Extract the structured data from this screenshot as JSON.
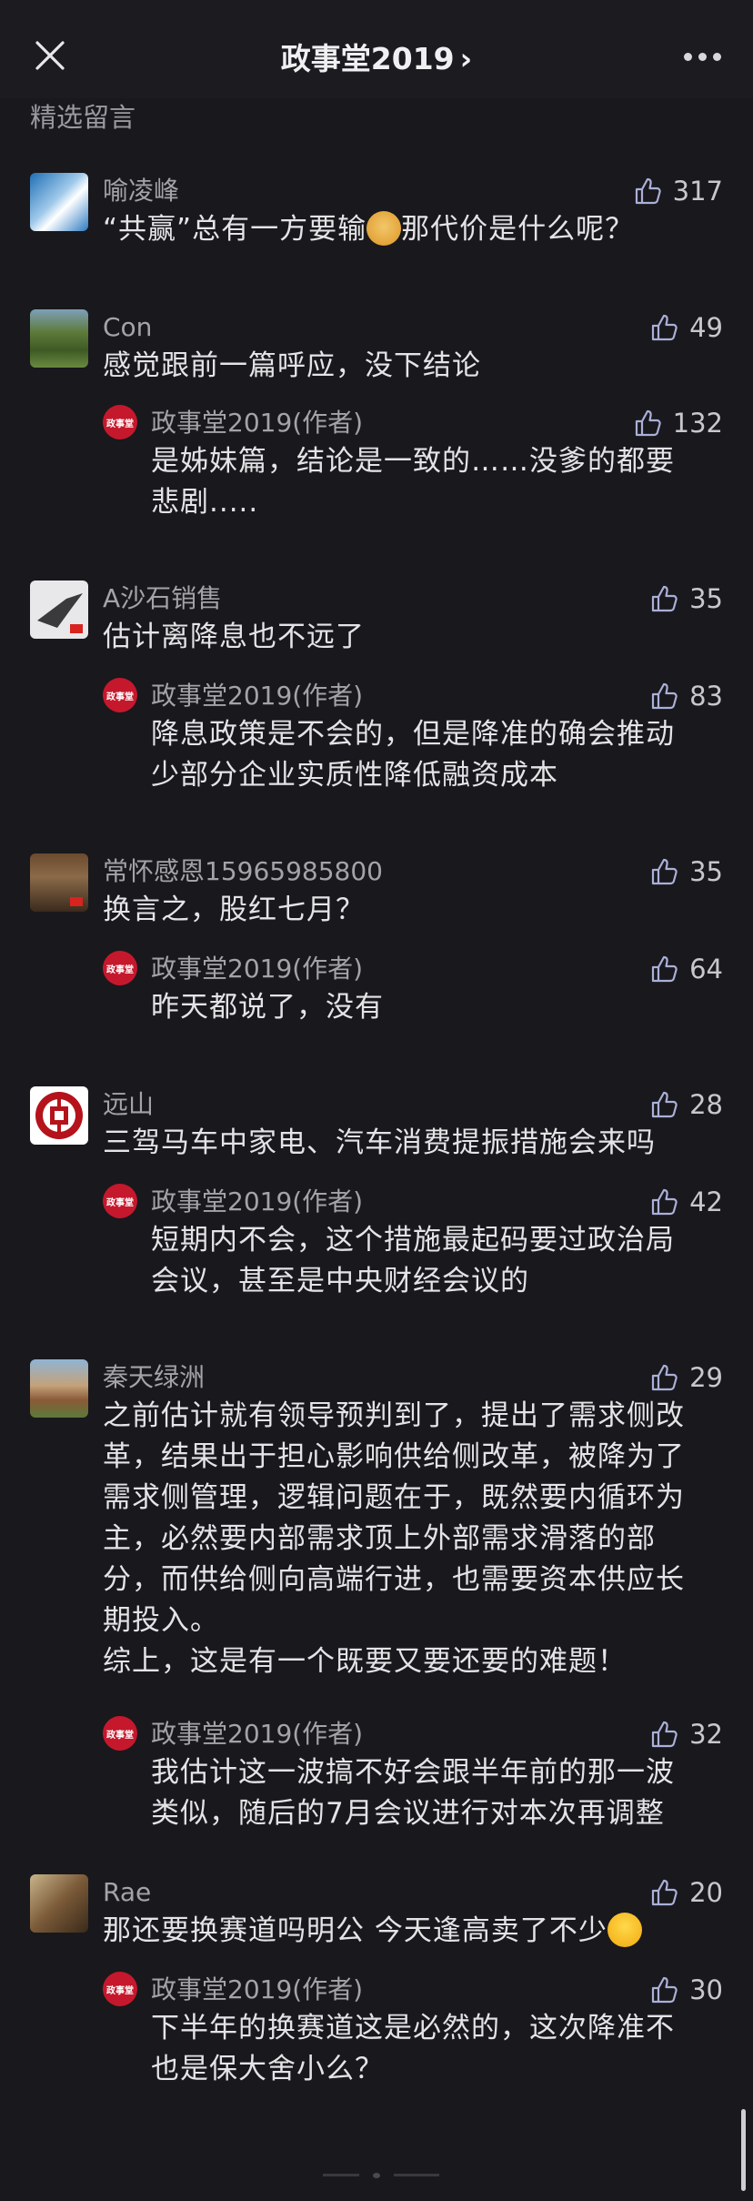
{
  "header": {
    "title": "政事堂2019",
    "chevron": "›"
  },
  "section_title": "精选留言",
  "comments": [
    {
      "name": "喻凌峰",
      "likes": "317",
      "text_before": "“共赢”总有一方要输",
      "text_after": "那代价是什么呢？"
    },
    {
      "name": "Con",
      "likes": "49",
      "text": "感觉跟前一篇呼应，没下结论",
      "reply": {
        "name": "政事堂2019(作者)",
        "likes": "132",
        "lines": [
          "是姊妹篇，结论是一致的……没爹的都要",
          "悲剧....."
        ]
      }
    },
    {
      "name": "A沙石销售",
      "likes": "35",
      "text": "估计离降息也不远了",
      "reply": {
        "name": "政事堂2019(作者)",
        "likes": "83",
        "lines": [
          "降息政策是不会的，但是降准的确会推动",
          "少部分企业实质性降低融资成本"
        ]
      }
    },
    {
      "name": "常怀感恩15965985800",
      "likes": "35",
      "text": "换言之，股红七月？",
      "reply": {
        "name": "政事堂2019(作者)",
        "likes": "64",
        "lines": [
          "昨天都说了，没有"
        ]
      }
    },
    {
      "name": "远山",
      "likes": "28",
      "text": "三驾马车中家电、汽车消费提振措施会来吗",
      "reply": {
        "name": "政事堂2019(作者)",
        "likes": "42",
        "lines": [
          "短期内不会，这个措施最起码要过政治局",
          "会议，甚至是中央财经会议的"
        ]
      }
    },
    {
      "name": "秦天绿洲",
      "likes": "29",
      "lines": [
        "之前估计就有领导预判到了，提出了需求侧改",
        "革，结果出于担心影响供给侧改革，被降为了",
        "需求侧管理，逻辑问题在于，既然要内循环为",
        "主，必然要内部需求顶上外部需求滑落的部",
        "分，而供给侧向高端行进，也需要资本供应长",
        "期投入。",
        "综上，这是有一个既要又要还要的难题！"
      ],
      "reply": {
        "name": "政事堂2019(作者)",
        "likes": "32",
        "lines": [
          "我估计这一波搞不好会跟半年前的那一波",
          "类似，随后的7月会议进行对本次再调整"
        ]
      }
    },
    {
      "name": "Rae",
      "likes": "20",
      "text_before": "那还要换赛道吗明公 今天逢高卖了不少",
      "reply": {
        "name": "政事堂2019(作者)",
        "likes": "30",
        "lines": [
          "下半年的换赛道这是必然的，这次降准不",
          "也是保大舍小么？"
        ]
      }
    }
  ],
  "author_badge": "政事堂",
  "icons": {
    "close": "close-icon",
    "more": "more-icon",
    "like": "thumb-up-icon"
  },
  "colors": {
    "background": "#19181d",
    "author_red": "#c5182c"
  }
}
